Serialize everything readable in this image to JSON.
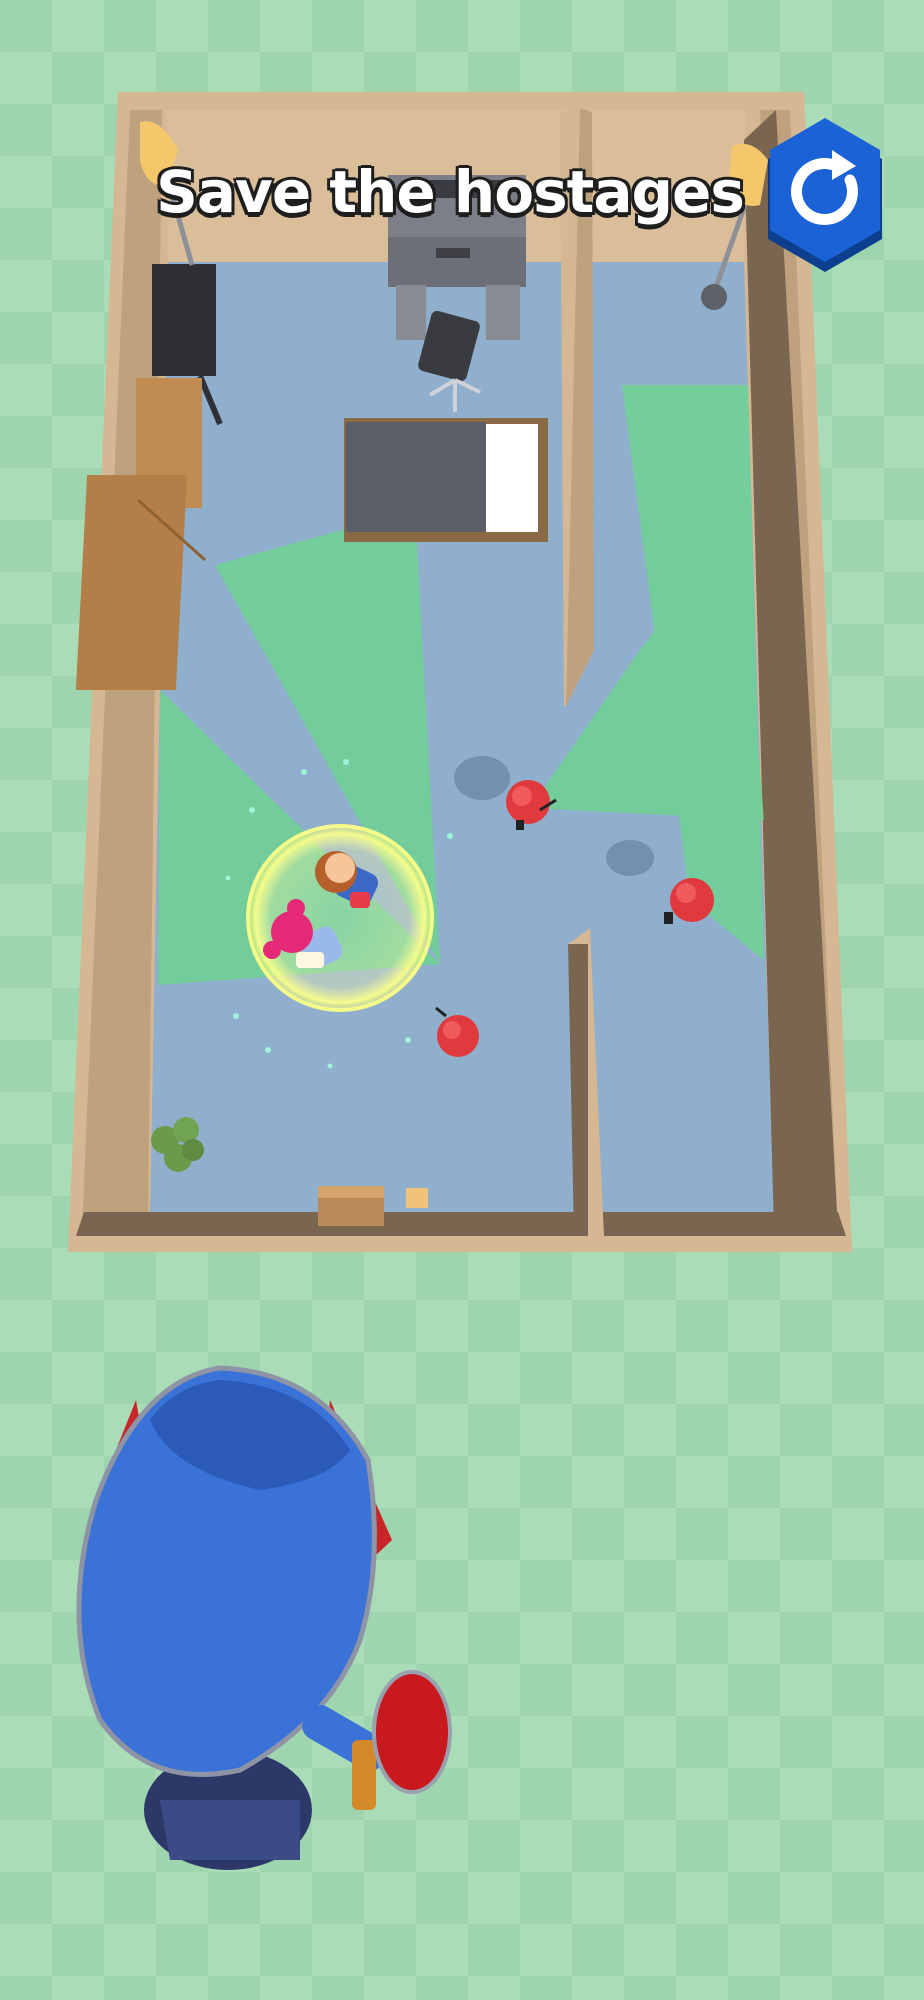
{
  "hud": {
    "objective_text": "Save the hostages",
    "restart_icon": "restart-icon"
  },
  "colors": {
    "grass_light": "#a9dcb7",
    "grass_dark": "#9fd5ae",
    "floor": "#8fafcd",
    "wall_top": "#d5b893",
    "wall_side": "#7a6650",
    "vision_cone": "#69d88a",
    "enemy_red": "#e03a3e",
    "player_blue": "#3a72d8",
    "button_blue": "#1a62d6"
  },
  "scene": {
    "enemies": 3,
    "hostages": 2
  }
}
